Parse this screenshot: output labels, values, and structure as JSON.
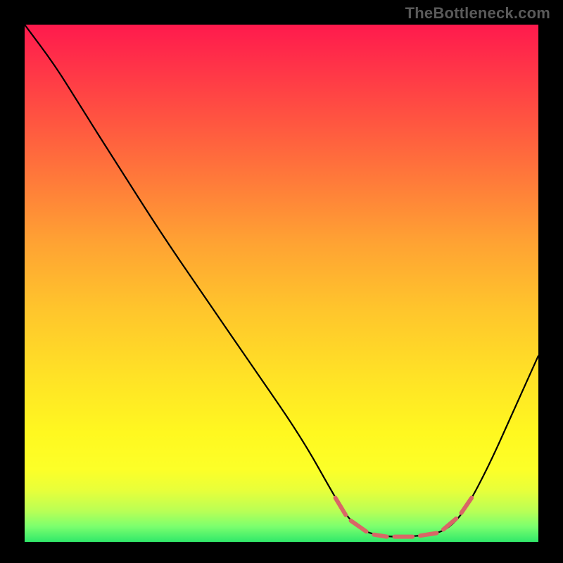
{
  "attribution": "TheBottleneck.com",
  "chart_data": {
    "type": "line",
    "title": "",
    "xlabel": "",
    "ylabel": "",
    "xlim": [
      0,
      100
    ],
    "ylim": [
      0,
      100
    ],
    "curve_normalized": [
      {
        "x": 0.0,
        "y": 1.0
      },
      {
        "x": 0.06,
        "y": 0.92
      },
      {
        "x": 0.11,
        "y": 0.84
      },
      {
        "x": 0.18,
        "y": 0.73
      },
      {
        "x": 0.27,
        "y": 0.59
      },
      {
        "x": 0.36,
        "y": 0.46
      },
      {
        "x": 0.45,
        "y": 0.33
      },
      {
        "x": 0.54,
        "y": 0.2
      },
      {
        "x": 0.605,
        "y": 0.085
      },
      {
        "x": 0.63,
        "y": 0.045
      },
      {
        "x": 0.66,
        "y": 0.02
      },
      {
        "x": 0.7,
        "y": 0.01
      },
      {
        "x": 0.75,
        "y": 0.01
      },
      {
        "x": 0.8,
        "y": 0.015
      },
      {
        "x": 0.83,
        "y": 0.03
      },
      {
        "x": 0.86,
        "y": 0.065
      },
      {
        "x": 0.905,
        "y": 0.15
      },
      {
        "x": 0.95,
        "y": 0.25
      },
      {
        "x": 1.0,
        "y": 0.36
      }
    ],
    "highlight_dashes_normalized": [
      {
        "x1": 0.605,
        "y1": 0.085,
        "x2": 0.625,
        "y2": 0.052
      },
      {
        "x1": 0.635,
        "y1": 0.041,
        "x2": 0.665,
        "y2": 0.02
      },
      {
        "x1": 0.68,
        "y1": 0.014,
        "x2": 0.705,
        "y2": 0.01
      },
      {
        "x1": 0.72,
        "y1": 0.01,
        "x2": 0.755,
        "y2": 0.01
      },
      {
        "x1": 0.77,
        "y1": 0.012,
        "x2": 0.802,
        "y2": 0.017
      },
      {
        "x1": 0.815,
        "y1": 0.024,
        "x2": 0.84,
        "y2": 0.045
      },
      {
        "x1": 0.85,
        "y1": 0.056,
        "x2": 0.87,
        "y2": 0.085
      }
    ],
    "colors": {
      "curve_stroke": "#000000",
      "highlight_stroke": "#d96666",
      "background_top": "#ff1a4d",
      "background_bottom": "#30e86a",
      "frame": "#000000"
    }
  }
}
